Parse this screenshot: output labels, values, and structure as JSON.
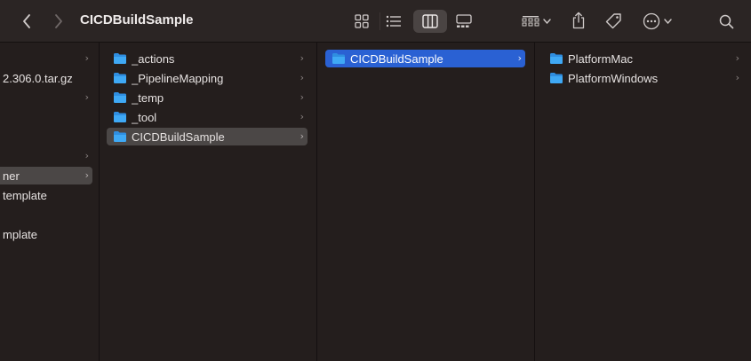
{
  "window": {
    "title": "CICDBuildSample"
  },
  "toolbar": {
    "back_icon": "chevron-left",
    "forward_icon": "chevron-right",
    "view_modes": [
      "icon-view",
      "list-view",
      "column-view",
      "gallery-view"
    ],
    "active_view": "column-view",
    "group_menu_icon": "group-grid",
    "share_icon": "share",
    "tag_icon": "tag",
    "more_icon": "ellipsis-circle",
    "search_icon": "magnifier"
  },
  "columns": [
    {
      "items": [
        {
          "label": "",
          "has_children": true
        },
        {
          "label": "2.306.0.tar.gz",
          "has_children": false
        },
        {
          "label": "",
          "has_children": true
        },
        {
          "label": "",
          "has_children": false
        },
        {
          "label": "",
          "has_children": false
        },
        {
          "label": "",
          "has_children": true
        },
        {
          "label": "ner",
          "has_children": true,
          "selected": true
        },
        {
          "label": "template",
          "has_children": false
        },
        {
          "label": "",
          "has_children": false
        },
        {
          "label": "mplate",
          "has_children": false
        }
      ]
    },
    {
      "items": [
        {
          "label": "_actions",
          "has_children": true
        },
        {
          "label": "_PipelineMapping",
          "has_children": true
        },
        {
          "label": "_temp",
          "has_children": true
        },
        {
          "label": "_tool",
          "has_children": true
        },
        {
          "label": "CICDBuildSample",
          "has_children": true,
          "selected": true
        }
      ]
    },
    {
      "items": [
        {
          "label": "CICDBuildSample",
          "has_children": true,
          "selected": true,
          "active": true
        }
      ]
    },
    {
      "items": [
        {
          "label": "PlatformMac",
          "has_children": true
        },
        {
          "label": "PlatformWindows",
          "has_children": true
        }
      ]
    }
  ],
  "colors": {
    "background": "#241e1d",
    "toolbar": "#2b2524",
    "selection_active": "#2a61d3",
    "selection_inactive": "#4b4746",
    "folder": "#3fa9f5"
  }
}
